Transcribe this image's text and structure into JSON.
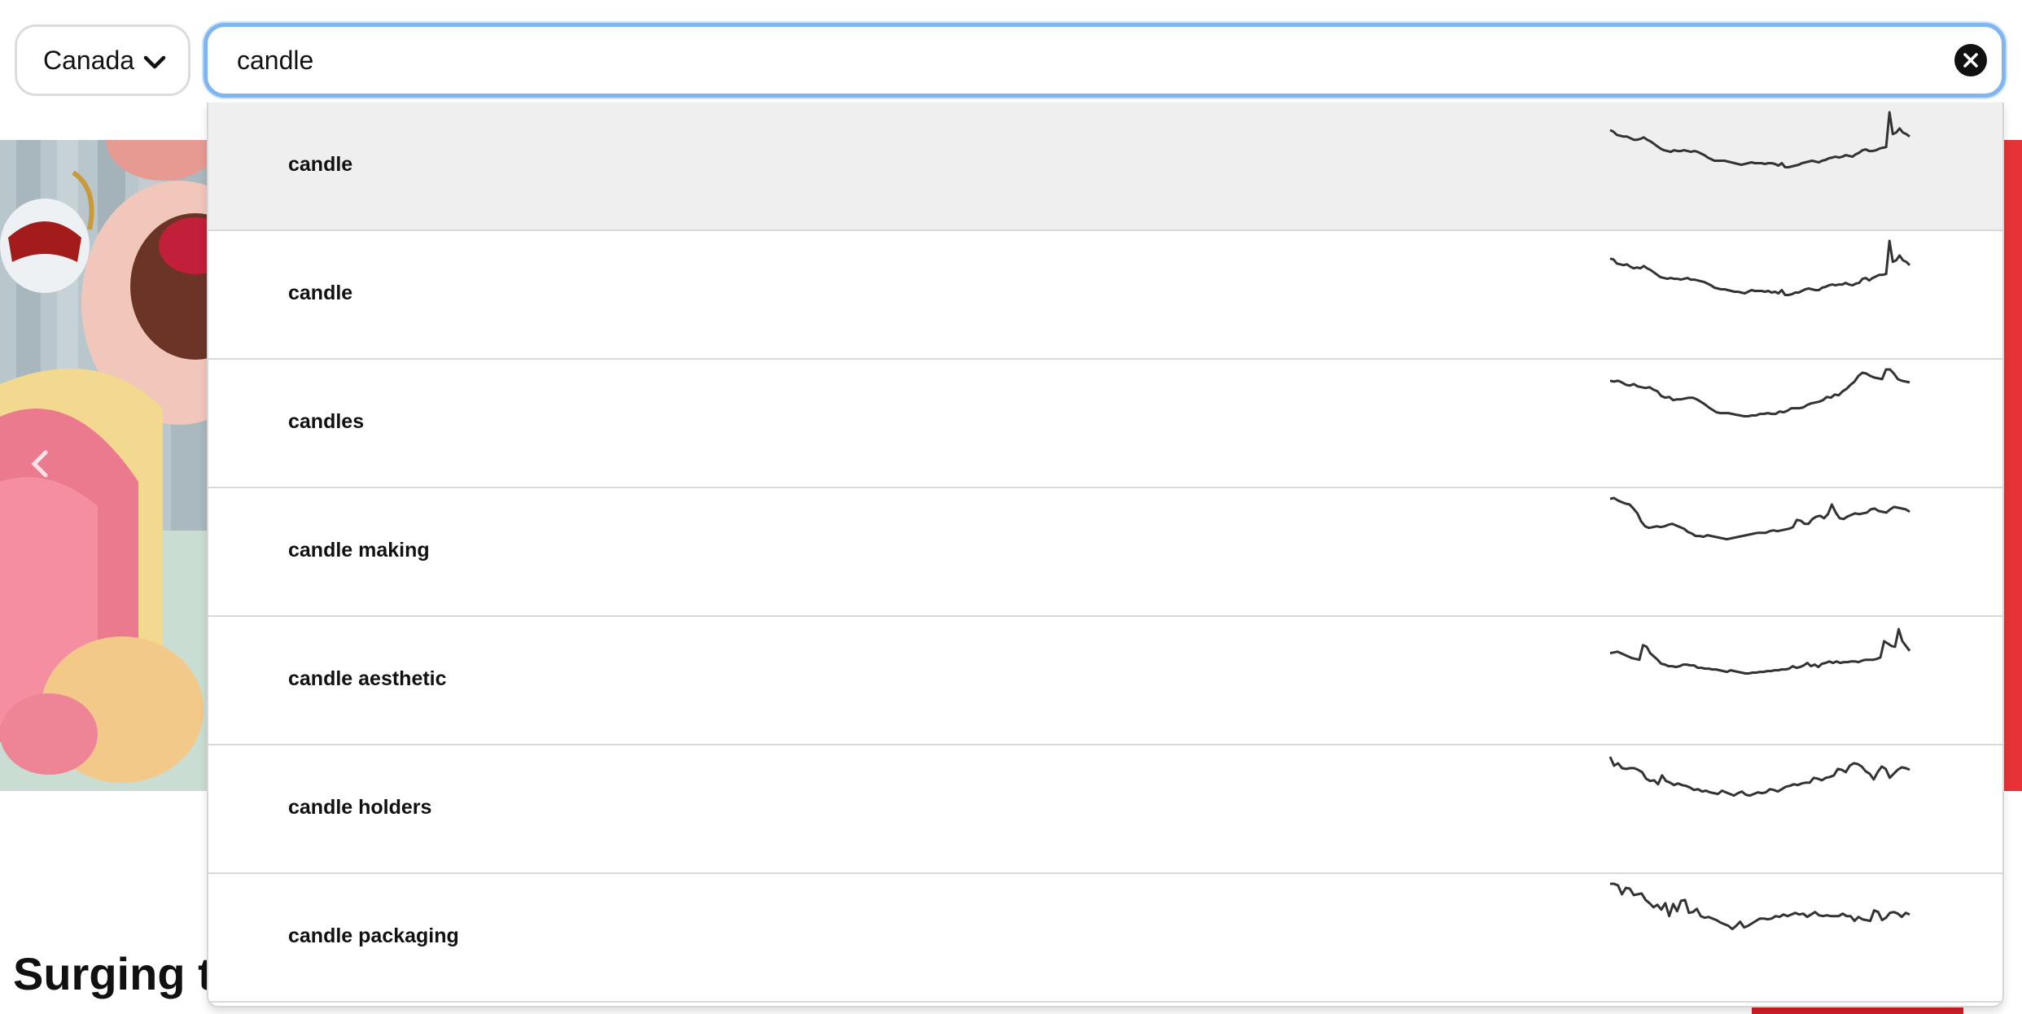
{
  "country_select": {
    "value": "Canada",
    "icon": "chevron-down-icon"
  },
  "search": {
    "value": "candle",
    "clear_icon": "close-circle-icon"
  },
  "colors": {
    "focus_ring": "#7fb5f0",
    "accent_red": "#e73237",
    "highlight_row": "#efefef"
  },
  "background": {
    "section_title": "Surging t"
  },
  "suggestions": [
    {
      "term": "candle",
      "highlighted": true,
      "trend": [
        22,
        24,
        28,
        29,
        30,
        30,
        32,
        34,
        34,
        33,
        31,
        34,
        36,
        39,
        42,
        45,
        47,
        48,
        49,
        47,
        48,
        48,
        47,
        48,
        49,
        48,
        49,
        51,
        53,
        56,
        58,
        60,
        60,
        60,
        60,
        61,
        62,
        63,
        64,
        65,
        64,
        63,
        62,
        63,
        63,
        63,
        64,
        63,
        63,
        64,
        66,
        63,
        68,
        68,
        67,
        66,
        65,
        63,
        62,
        61,
        60,
        61,
        62,
        60,
        59,
        57,
        56,
        55,
        56,
        55,
        53,
        54,
        55,
        52,
        50,
        47,
        46,
        48,
        48,
        47,
        45,
        44,
        43,
        0,
        27,
        25,
        20,
        25,
        27,
        30
      ]
    },
    {
      "term": "candle",
      "highlighted": false,
      "trend": [
        22,
        23,
        28,
        29,
        30,
        29,
        32,
        34,
        33,
        34,
        31,
        34,
        36,
        39,
        42,
        45,
        46,
        47,
        46,
        47,
        47,
        48,
        47,
        46,
        48,
        48,
        49,
        50,
        51,
        53,
        55,
        58,
        59,
        60,
        60,
        61,
        62,
        63,
        63,
        64,
        65,
        63,
        61,
        62,
        62,
        62,
        63,
        62,
        64,
        63,
        65,
        61,
        67,
        67,
        66,
        64,
        64,
        62,
        60,
        59,
        60,
        61,
        61,
        58,
        57,
        55,
        54,
        55,
        54,
        54,
        52,
        54,
        55,
        53,
        52,
        47,
        46,
        49,
        46,
        44,
        42,
        42,
        41,
        0,
        26,
        24,
        18,
        24,
        26,
        30
      ]
    },
    {
      "term": "candles",
      "highlighted": false,
      "trend": [
        14,
        15,
        14,
        16,
        19,
        20,
        18,
        21,
        22,
        23,
        22,
        25,
        27,
        33,
        35,
        34,
        38,
        37,
        37,
        36,
        35,
        35,
        37,
        40,
        43,
        47,
        50,
        53,
        54,
        54,
        54,
        55,
        56,
        57,
        58,
        58,
        57,
        57,
        55,
        55,
        54,
        55,
        55,
        52,
        53,
        51,
        48,
        48,
        48,
        47,
        44,
        42,
        41,
        40,
        38,
        34,
        35,
        31,
        32,
        27,
        24,
        19,
        15,
        8,
        4,
        5,
        8,
        10,
        11,
        12,
        0,
        0,
        5,
        12,
        14,
        15,
        16
      ]
    },
    {
      "term": "candle making",
      "highlighted": false,
      "trend": [
        1,
        0,
        3,
        5,
        7,
        8,
        13,
        19,
        29,
        35,
        37,
        36,
        35,
        36,
        35,
        33,
        32,
        34,
        36,
        38,
        42,
        44,
        47,
        47,
        48,
        46,
        47,
        48,
        49,
        50,
        51,
        50,
        49,
        48,
        47,
        46,
        45,
        44,
        43,
        43,
        43,
        41,
        40,
        41,
        40,
        39,
        38,
        36,
        27,
        28,
        32,
        32,
        26,
        23,
        22,
        25,
        20,
        8,
        18,
        25,
        26,
        23,
        21,
        19,
        20,
        19,
        18,
        14,
        13,
        16,
        17,
        18,
        14,
        11,
        12,
        13,
        14,
        17
      ]
    },
    {
      "term": "candle aesthetic",
      "highlighted": false,
      "trend": [
        33,
        32,
        31,
        33,
        35,
        37,
        39,
        40,
        41,
        23,
        25,
        33,
        37,
        41,
        46,
        47,
        49,
        49,
        50,
        49,
        47,
        47,
        48,
        48,
        51,
        51,
        52,
        52,
        53,
        53,
        54,
        55,
        56,
        54,
        55,
        56,
        57,
        58,
        58,
        57,
        57,
        56,
        56,
        55,
        55,
        54,
        54,
        53,
        53,
        52,
        49,
        51,
        50,
        48,
        45,
        49,
        47,
        50,
        46,
        45,
        43,
        45,
        43,
        45,
        44,
        44,
        43,
        43,
        44,
        42,
        41,
        41,
        41,
        40,
        38,
        18,
        21,
        24,
        25,
        3,
        18,
        24,
        30
      ]
    },
    {
      "term": "candle holders",
      "highlighted": false,
      "trend": [
        2,
        13,
        10,
        16,
        17,
        16,
        16,
        18,
        21,
        29,
        32,
        31,
        36,
        25,
        32,
        34,
        37,
        35,
        37,
        38,
        40,
        43,
        42,
        45,
        44,
        46,
        47,
        48,
        44,
        46,
        48,
        50,
        47,
        45,
        49,
        50,
        48,
        46,
        47,
        46,
        42,
        43,
        45,
        42,
        39,
        38,
        36,
        37,
        35,
        34,
        34,
        28,
        29,
        31,
        28,
        27,
        25,
        17,
        18,
        21,
        13,
        10,
        11,
        14,
        20,
        23,
        30,
        21,
        14,
        17,
        28,
        23,
        18,
        15,
        16,
        18
      ]
    },
    {
      "term": "candle packaging",
      "highlighted": false,
      "trend": [
        0,
        0,
        2,
        13,
        5,
        6,
        14,
        13,
        12,
        20,
        24,
        29,
        26,
        32,
        24,
        40,
        25,
        34,
        21,
        20,
        36,
        35,
        31,
        40,
        42,
        41,
        43,
        45,
        48,
        50,
        52,
        56,
        52,
        47,
        54,
        52,
        49,
        46,
        43,
        43,
        44,
        43,
        40,
        41,
        38,
        40,
        38,
        36,
        38,
        37,
        41,
        38,
        35,
        39,
        40,
        39,
        40,
        40,
        40,
        37,
        40,
        40,
        46,
        41,
        44,
        45,
        46,
        33,
        35,
        45,
        42,
        36,
        35,
        37,
        41,
        36,
        38
      ]
    }
  ]
}
